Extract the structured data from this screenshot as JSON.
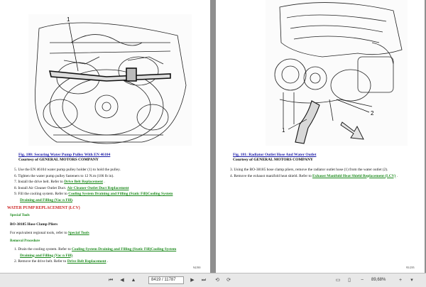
{
  "left_page": {
    "callout_1": "1",
    "figure_caption": "Fig. 180: Securing Water Pump Pulley With EN 46104",
    "courtesy": "Courtesy of GENERAL MOTORS COMPANY",
    "steps": [
      {
        "text": "5. Use the EN 46104 water pump pulley holder (1) to hold the pulley.",
        "link": "",
        "tail": ""
      },
      {
        "text": "6. Tighten the water pump pulley fasteners to 12 N.m (106 lb in).",
        "link": "",
        "tail": ""
      },
      {
        "text": "7. Install the drive belt. Refer to ",
        "link": "Drive Belt Replacement",
        "tail": " ."
      },
      {
        "text": "8. Install Air Cleaner Outlet Duct. ",
        "link": "Air Cleaner Outlet Duct Replacement",
        "tail": ""
      },
      {
        "text": "9. Fill the cooling system. Refer to ",
        "link": "Cooling System Draining and Filling (Static Fill)Cooling System",
        "tail": ""
      },
      {
        "text": "",
        "link": "Draining and Filling (Vac n Fill)",
        "tail": "."
      }
    ],
    "section_title": "WATER PUMP REPLACEMENT (LCV)",
    "special_tools_heading": "Special Tools",
    "tool_line": "BO-38185 Hose Clamp Pliers",
    "regional_text": "For equivalent regional tools, refer to ",
    "regional_link": "Special Tools",
    "removal_heading": "Removal Procedure",
    "removal_steps": [
      {
        "text": "1. Drain the cooling system. Refer to ",
        "link": "Cooling System Draining and Filling (Static Fill)Cooling System",
        "tail": ""
      },
      {
        "text": "",
        "link": "Draining and Filling (Vac n Fill)",
        "tail": "."
      },
      {
        "text": "2. Remove the drive belt. Refer to ",
        "link": "Drive Belt Replacement",
        "tail": " ."
      }
    ],
    "page_number": "94190"
  },
  "right_page": {
    "callout_1": "1",
    "callout_2": "2",
    "figure_caption": "Fig. 181: Radiator Outlet Hose And Water Outlet",
    "courtesy": "Courtesy of GENERAL MOTORS COMPANY",
    "steps": [
      {
        "text": "3. Using the BO-38185 hose clamp pliers, remove the radiator outlet hose (1) from the water outlet (2).",
        "link": "",
        "tail": ""
      },
      {
        "text": "4. Remove the exhaust manifold heat shield. Refer to ",
        "link": "Exhaust Manifold Heat Shield Replacement (LCV)",
        "tail": " ."
      }
    ],
    "page_number": "95/295"
  },
  "statusbar": {
    "page_value": "8419 / 11787",
    "zoom_value": "89,68%",
    "icons": [
      "first-page-icon",
      "prev-page-icon",
      "next-page-icon",
      "last-page-icon",
      "back-icon",
      "forward-icon",
      "zoom-out-icon",
      "zoom-in-icon",
      "fit-icon"
    ]
  }
}
